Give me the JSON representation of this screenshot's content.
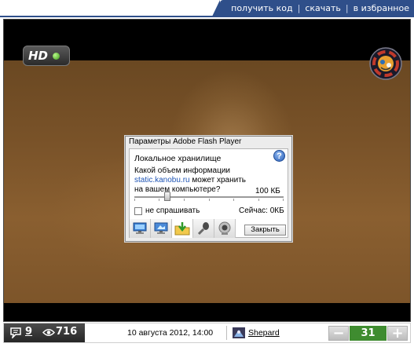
{
  "topnav": {
    "links": [
      "получить код",
      "скачать",
      "в избранное"
    ],
    "separator": "|"
  },
  "player": {
    "hd_badge": "HD",
    "logo_icon": "kanobu-logo-icon"
  },
  "flash_dialog": {
    "title": "Параметры Adobe Flash Player",
    "section": "Локальное хранилище",
    "help_label": "?",
    "question_before": "Какой объем информации",
    "domain": "static.kanobu.ru",
    "question_after": "может хранить на вашем компьютере?",
    "size_value": "100 КБ",
    "slider_level_fraction": 0.22,
    "checkbox_label": "не спрашивать",
    "checkbox_checked": false,
    "current_usage": "Сейчас: 0КБ",
    "tabs": [
      {
        "icon": "privacy-monitor-icon",
        "active": false
      },
      {
        "icon": "display-monitor-icon",
        "active": false
      },
      {
        "icon": "local-storage-folder-icon",
        "active": true
      },
      {
        "icon": "microphone-icon",
        "active": false
      },
      {
        "icon": "webcam-icon",
        "active": false
      }
    ],
    "close_button": "Закрыть"
  },
  "bottom_bar": {
    "comments_icon": "comments-icon",
    "comments_count": "9",
    "views_icon": "eye-icon",
    "views_count": "716",
    "date": "10 августа 2012, 14:00",
    "user_icon": "user-avatar-icon",
    "user_name": "Shepard",
    "minus_label": "−",
    "score": "31",
    "plus_label": "+",
    "score_color": "#3f8c30"
  }
}
